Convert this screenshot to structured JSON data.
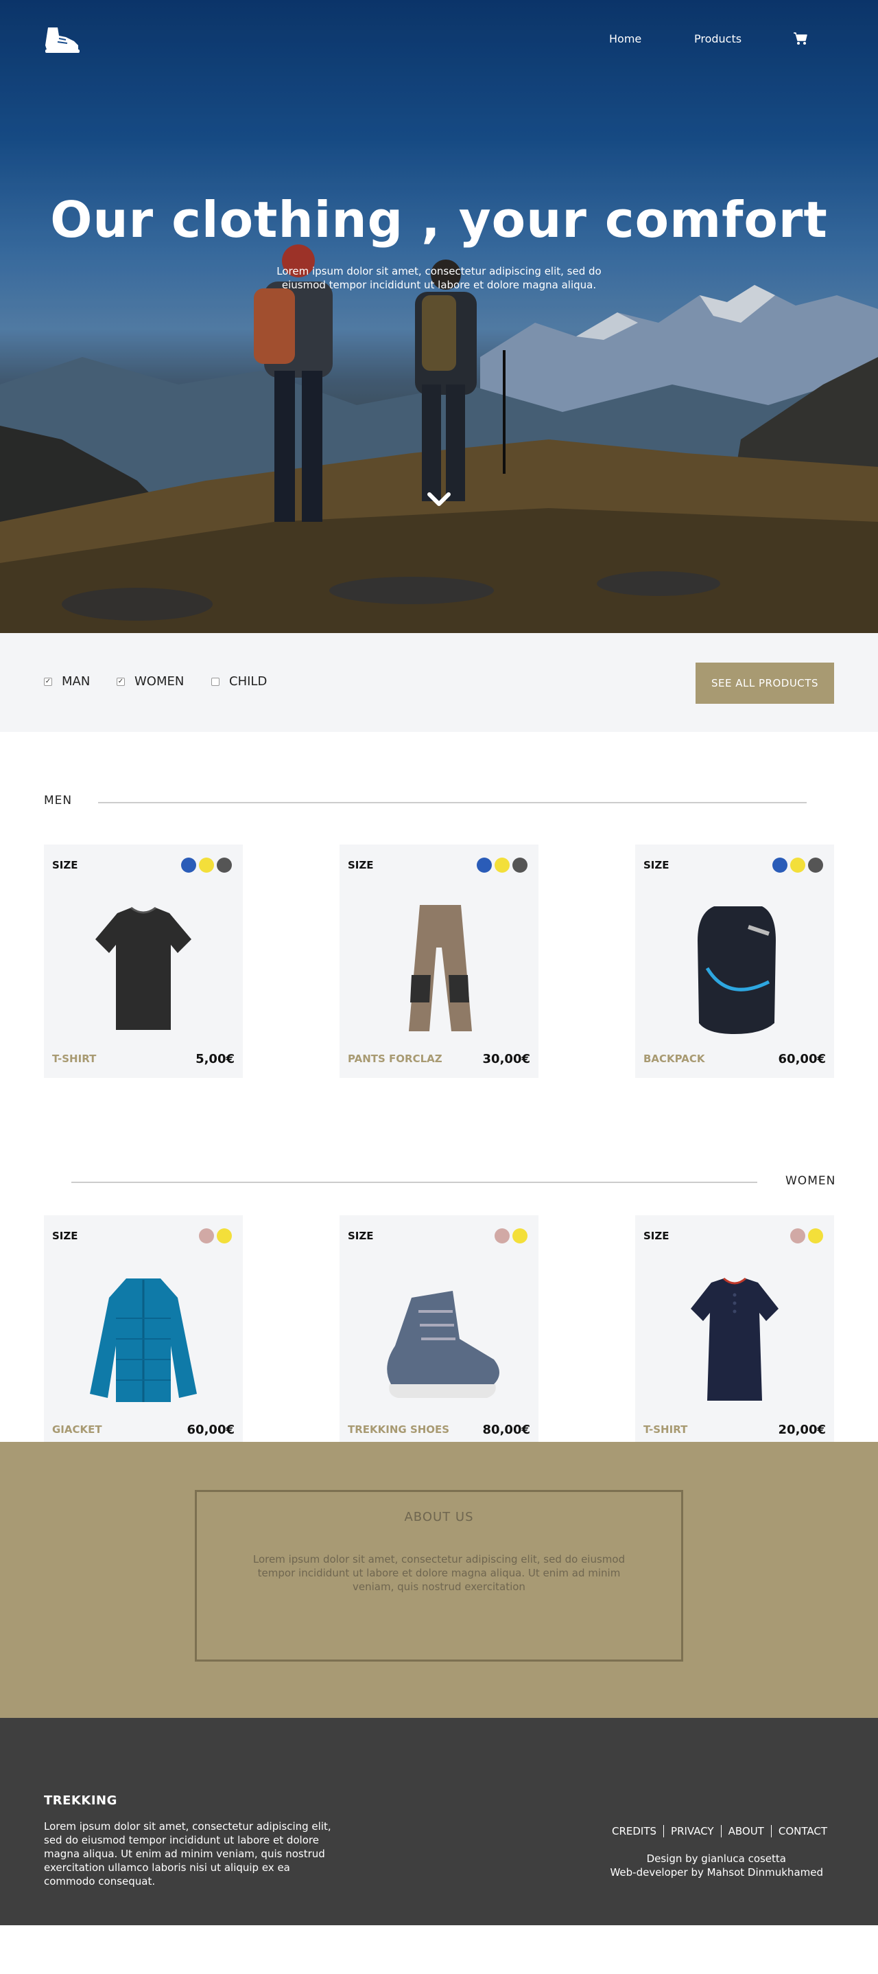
{
  "nav": {
    "home": "Home",
    "products": "Products",
    "cart_icon": "cart-icon",
    "logo_icon": "hiking-boot-logo"
  },
  "hero": {
    "title": "Our clothing , your comfort",
    "subtitle": "Lorem ipsum dolor sit amet, consectetur adipiscing elit, sed do eiusmod tempor incididunt ut labore et dolore magna aliqua.",
    "scroll_icon": "chevron-down-icon"
  },
  "filter": {
    "options": [
      {
        "label": "MAN",
        "checked": true
      },
      {
        "label": "WOMEN",
        "checked": true
      },
      {
        "label": "CHILD",
        "checked": false
      }
    ],
    "see_all": "SEE ALL PRODUCTS"
  },
  "men": {
    "title": "MEN",
    "products": [
      {
        "size": "SIZE",
        "name": "T-SHIRT",
        "price": "5,00€",
        "colors": [
          "#2a5cb8",
          "#f3df3a",
          "#555555"
        ]
      },
      {
        "size": "SIZE",
        "name": "PANTS FORCLAZ",
        "price": "30,00€",
        "colors": [
          "#2a5cb8",
          "#f3df3a",
          "#555555"
        ]
      },
      {
        "size": "SIZE",
        "name": "BACKPACK",
        "price": "60,00€",
        "colors": [
          "#2a5cb8",
          "#f3df3a",
          "#555555"
        ]
      }
    ]
  },
  "women": {
    "title": "WOMEN",
    "products": [
      {
        "size": "SIZE",
        "name": "GIACKET",
        "price": "60,00€",
        "colors": [
          "#d1a9a5",
          "#f3df3a"
        ]
      },
      {
        "size": "SIZE",
        "name": "TREKKING SHOES",
        "price": "80,00€",
        "colors": [
          "#d1a9a5",
          "#f3df3a"
        ]
      },
      {
        "size": "SIZE",
        "name": "T-SHIRT",
        "price": "20,00€",
        "colors": [
          "#d1a9a5",
          "#f3df3a"
        ]
      }
    ]
  },
  "about": {
    "title": "ABOUT US",
    "text": "Lorem ipsum dolor sit amet, consectetur adipiscing elit, sed do eiusmod tempor incididunt ut labore et dolore magna aliqua. Ut enim ad minim veniam, quis nostrud exercitation"
  },
  "footer": {
    "brand": "TREKKING",
    "text": "Lorem ipsum dolor sit amet, consectetur adipiscing elit, sed do eiusmod tempor incididunt ut labore et dolore magna aliqua. Ut enim ad minim veniam, quis nostrud exercitation ullamco laboris nisi ut aliquip ex ea commodo consequat.",
    "links": [
      "CREDITS",
      "PRIVACY",
      "ABOUT",
      "CONTACT"
    ],
    "design_credit": "Design by gianluca cosetta",
    "dev_credit": "Web-developer by Mahsot Dinmukhamed"
  },
  "colors": {
    "accent": "#a89a72",
    "footer_bg": "#3f3f3f",
    "card_bg": "#f4f5f7"
  }
}
